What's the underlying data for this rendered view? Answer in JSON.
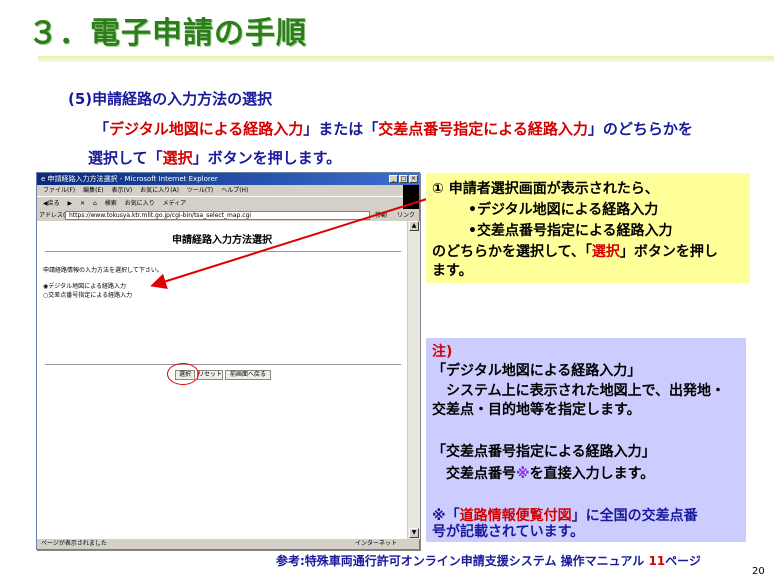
{
  "slide": {
    "title": "３．電子申請の手順",
    "step_heading": "(5)申請経路の入力方法の選択",
    "line1_q1": "「",
    "line1_opt1": "デジタル地図による経路入力",
    "line1_q2": "」または「",
    "line1_opt2": "交差点番号指定による経路入力",
    "line1_q3": "」のどちらかを",
    "line2_a": "選択して「",
    "line2_sel": "選択",
    "line2_b": "」ボタンを押します。",
    "page_number": "20"
  },
  "browser": {
    "window_title": "申請経路入力方法選択 - Microsoft Internet Explorer",
    "menu": [
      "ファイル(F)",
      "編集(E)",
      "表示(V)",
      "お気に入り(A)",
      "ツール(T)",
      "ヘルプ(H)"
    ],
    "toolbar": [
      "◀戻る",
      "▶",
      "✕",
      "⌂",
      "検索",
      "お気に入り",
      "メディア"
    ],
    "address_label": "アドレス(D)",
    "address_value": "https://www.tokusya.ktr.mlit.go.jp/cgi-bin/tsa_select_map.cgi",
    "go_label": "移動",
    "links_label": "リンク",
    "page_title": "申請経路入力方法選択",
    "instruction": "申請経路情報の入力方法を選択して下さい。",
    "radio_option1": "デジタル地図による経路入力",
    "radio_option2": "交差点番号指定による経路入力",
    "btn_select": "選択",
    "btn_reset": "リセット",
    "btn_back": "前画面へ戻る",
    "status_left": "ページが表示されました",
    "status_right": "インターネット"
  },
  "callout1": {
    "l1": "① 申請者選択画面が表示されたら、",
    "l2": "•デジタル地図による経路入力",
    "l3": "•交差点番号指定による経路入力",
    "l4": "のどちらかを選択して、「",
    "l4_sel": "選択",
    "l4_end": "」ボタンを押し",
    "l5": "ます。"
  },
  "callout2": {
    "note": "注)",
    "h1": "「デジタル地図による経路入力」",
    "d1a": "　システム上に表示された地図上で、出発地・",
    "d1b": "交差点・目的地等を指定します。",
    "h2": "「交差点番号指定による経路入力」",
    "d2a": "　交差点番号",
    "d2mark": "※",
    "d2b": "を直接入力します。",
    "n_mark": "※「",
    "n_red": "道路情報便覧付図",
    "n_rest": "」に全国の交差点番",
    "n_line2": "号が記載されています。"
  },
  "footer": {
    "ref_a": "参考:特殊車両通行許可オンライン申請支援システム 操作マニュアル ",
    "ref_num": "11",
    "ref_b": "ページ"
  },
  "colors": {
    "title": "#2e7d1c",
    "body_text": "#1a1a9c",
    "highlight": "#d40000",
    "callout1_bg": "#ffff99",
    "callout2_bg": "#ccccff"
  }
}
